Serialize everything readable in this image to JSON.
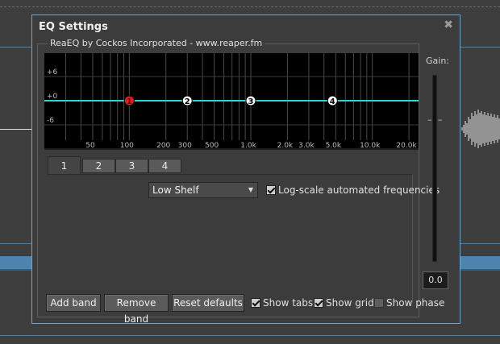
{
  "dialog": {
    "title": "EQ Settings",
    "close_glyph": "✖",
    "plugin_label": "ReaEQ by Cockos Incorporated - www.reaper.fm"
  },
  "graph": {
    "db_labels": [
      "+6",
      "+0",
      "-6"
    ],
    "freq_labels": [
      "50",
      "100",
      "200",
      "300",
      "500",
      "1.0k",
      "2.0k",
      "3.0k",
      "5.0k",
      "10.0k",
      "20.0k"
    ],
    "curve_color": "#2fd3d3",
    "band_nodes": [
      {
        "label": "1",
        "freq_hz": 100,
        "gain_db": 0,
        "color": "#e02020"
      },
      {
        "label": "2",
        "freq_hz": 300,
        "gain_db": 0,
        "color": "#ffffff"
      },
      {
        "label": "3",
        "freq_hz": 1000,
        "gain_db": 0,
        "color": "#ffffff"
      },
      {
        "label": "4",
        "freq_hz": 4700,
        "gain_db": 0,
        "color": "#ffffff"
      }
    ]
  },
  "tabs": [
    {
      "label": "1",
      "active": true
    },
    {
      "label": "2",
      "active": false
    },
    {
      "label": "3",
      "active": false
    },
    {
      "label": "4",
      "active": false
    }
  ],
  "band": {
    "type_selected": "Low Shelf",
    "log_scale_label": "Log-scale automated frequencies",
    "log_scale_checked": true
  },
  "gain": {
    "label": "Gain:",
    "marker": "– –",
    "value": "0.0"
  },
  "buttons": {
    "add_band": "Add band",
    "remove_band": "Remove band",
    "reset_defaults": "Reset defaults"
  },
  "options": {
    "show_tabs": {
      "label": "Show tabs",
      "checked": true
    },
    "show_grid": {
      "label": "Show grid",
      "checked": true
    },
    "show_phase": {
      "label": "Show phase",
      "checked": false
    }
  }
}
